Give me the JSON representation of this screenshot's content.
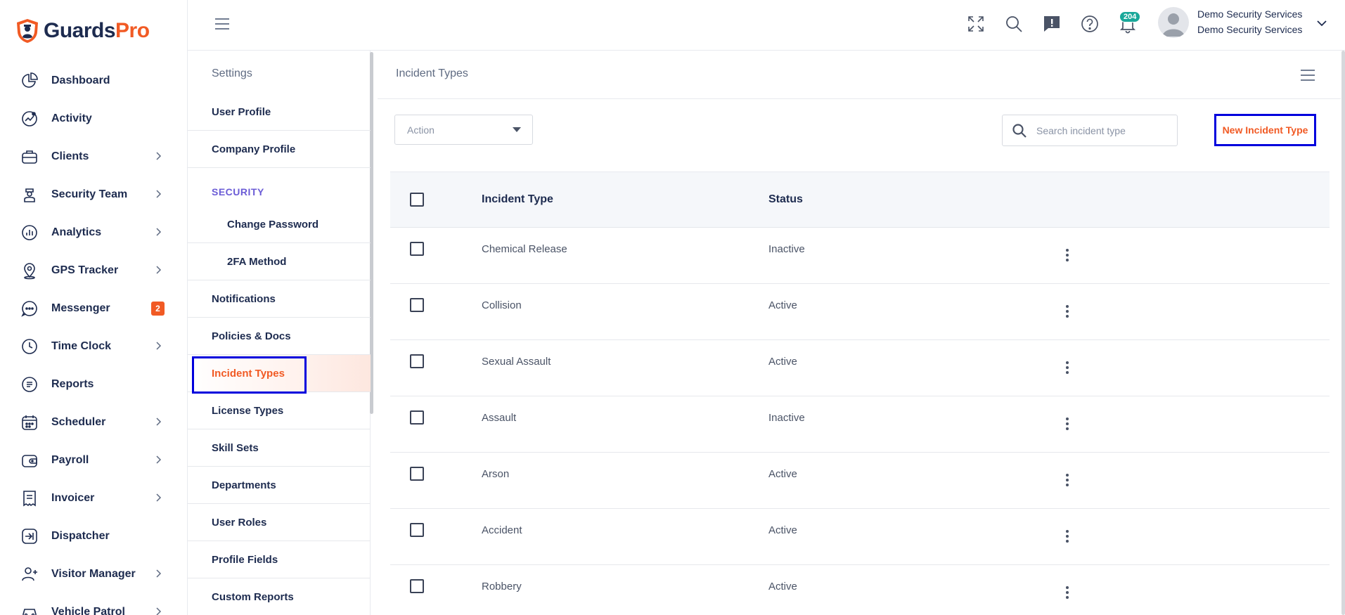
{
  "brand": {
    "part1": "Guards",
    "part2": "Pro",
    "accent": "#f15a24",
    "dark": "#1d2b4f"
  },
  "sidebar": {
    "items": [
      {
        "label": "Dashboard",
        "icon": "pie-chart-icon",
        "has_chevron": false
      },
      {
        "label": "Activity",
        "icon": "activity-icon",
        "has_chevron": false
      },
      {
        "label": "Clients",
        "icon": "briefcase-icon",
        "has_chevron": true
      },
      {
        "label": "Security Team",
        "icon": "guard-icon",
        "has_chevron": true
      },
      {
        "label": "Analytics",
        "icon": "analytics-icon",
        "has_chevron": true
      },
      {
        "label": "GPS Tracker",
        "icon": "location-pin-icon",
        "has_chevron": true
      },
      {
        "label": "Messenger",
        "icon": "chat-icon",
        "has_chevron": false,
        "badge": "2"
      },
      {
        "label": "Time Clock",
        "icon": "clock-icon",
        "has_chevron": true
      },
      {
        "label": "Reports",
        "icon": "report-icon",
        "has_chevron": false
      },
      {
        "label": "Scheduler",
        "icon": "calendar-icon",
        "has_chevron": true
      },
      {
        "label": "Payroll",
        "icon": "wallet-icon",
        "has_chevron": true
      },
      {
        "label": "Invoicer",
        "icon": "invoice-icon",
        "has_chevron": true
      },
      {
        "label": "Dispatcher",
        "icon": "dispatch-icon",
        "has_chevron": false
      },
      {
        "label": "Visitor Manager",
        "icon": "visitor-icon",
        "has_chevron": true
      },
      {
        "label": "Vehicle Patrol",
        "icon": "car-icon",
        "has_chevron": true
      }
    ]
  },
  "header": {
    "notification_count": "204",
    "user_name": "Demo Security Services",
    "user_org": "Demo Security Services",
    "notif_color": "#1aa89a"
  },
  "settings": {
    "title": "Settings",
    "user_profile": "User Profile",
    "company_profile": "Company Profile",
    "security_section": "SECURITY",
    "change_password": "Change Password",
    "twofa": "2FA Method",
    "notifications": "Notifications",
    "policies": "Policies & Docs",
    "incident_types": "Incident Types",
    "license_types": "License Types",
    "skill_sets": "Skill Sets",
    "departments": "Departments",
    "user_roles": "User Roles",
    "profile_fields": "Profile Fields",
    "custom_reports": "Custom Reports"
  },
  "main": {
    "title": "Incident Types",
    "action_label": "Action",
    "search_placeholder": "Search incident type",
    "new_button": "New Incident Type",
    "columns": {
      "type": "Incident Type",
      "status": "Status"
    },
    "rows": [
      {
        "type": "Chemical Release",
        "status": "Inactive"
      },
      {
        "type": "Collision",
        "status": "Active"
      },
      {
        "type": "Sexual Assault",
        "status": "Active"
      },
      {
        "type": "Assault",
        "status": "Inactive"
      },
      {
        "type": "Arson",
        "status": "Active"
      },
      {
        "type": "Accident",
        "status": "Active"
      },
      {
        "type": "Robbery",
        "status": "Active"
      }
    ]
  }
}
